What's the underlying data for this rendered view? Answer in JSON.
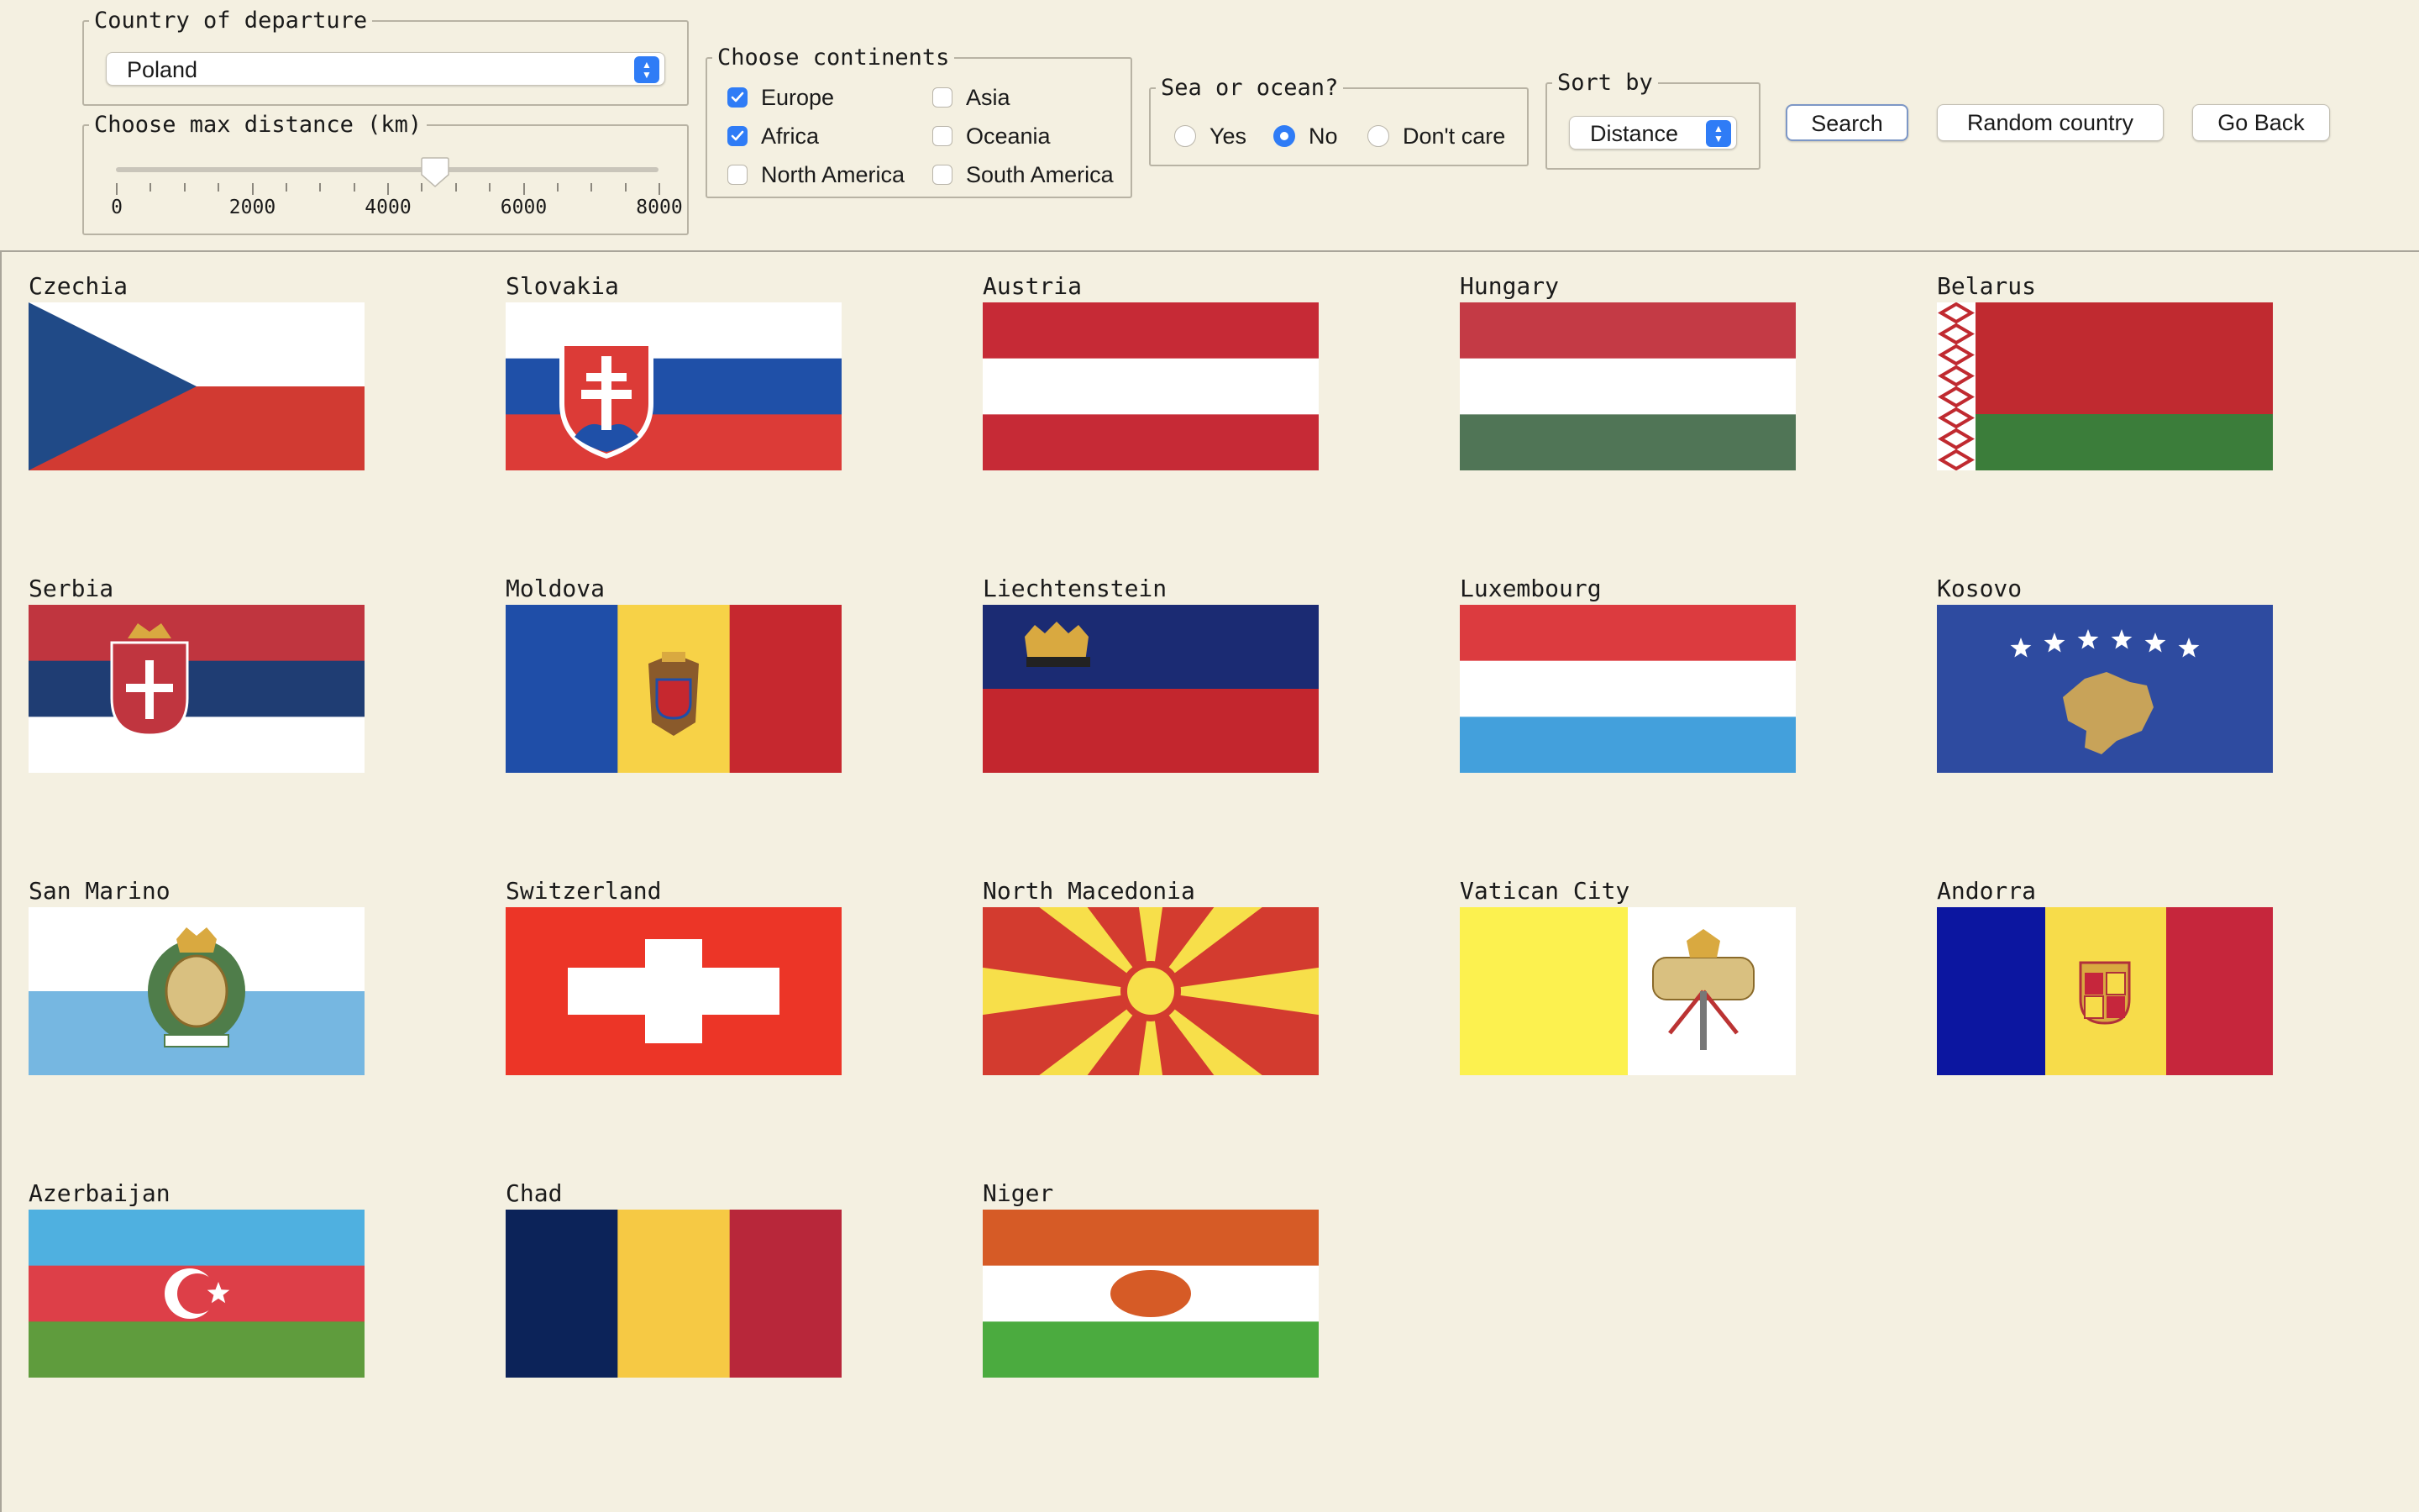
{
  "departure": {
    "legend": "Country of departure",
    "selected": "Poland"
  },
  "distance": {
    "legend": "Choose max distance (km)",
    "value_km": 4700,
    "min": 0,
    "max": 8000,
    "tick_labels": [
      "0",
      "2000",
      "4000",
      "6000",
      "8000"
    ]
  },
  "continents": {
    "legend": "Choose continents",
    "items": [
      {
        "label": "Europe",
        "checked": true
      },
      {
        "label": "Africa",
        "checked": true
      },
      {
        "label": "North America",
        "checked": false
      },
      {
        "label": "Asia",
        "checked": false
      },
      {
        "label": "Oceania",
        "checked": false
      },
      {
        "label": "South America",
        "checked": false
      }
    ]
  },
  "sea": {
    "legend": "Sea or ocean?",
    "options": [
      {
        "label": "Yes",
        "selected": false
      },
      {
        "label": "No",
        "selected": true
      },
      {
        "label": "Don't care",
        "selected": false
      }
    ]
  },
  "sort": {
    "legend": "Sort by",
    "selected": "Distance"
  },
  "buttons": {
    "search": "Search",
    "random": "Random country",
    "back": "Go Back"
  },
  "countries": [
    {
      "name": "Czechia",
      "flag": "czechia"
    },
    {
      "name": "Slovakia",
      "flag": "slovakia"
    },
    {
      "name": "Austria",
      "flag": "austria"
    },
    {
      "name": "Hungary",
      "flag": "hungary"
    },
    {
      "name": "Belarus",
      "flag": "belarus"
    },
    {
      "name": "Serbia",
      "flag": "serbia"
    },
    {
      "name": "Moldova",
      "flag": "moldova"
    },
    {
      "name": "Liechtenstein",
      "flag": "liechtenstein"
    },
    {
      "name": "Luxembourg",
      "flag": "luxembourg"
    },
    {
      "name": "Kosovo",
      "flag": "kosovo"
    },
    {
      "name": "San Marino",
      "flag": "san-marino"
    },
    {
      "name": "Switzerland",
      "flag": "switzerland"
    },
    {
      "name": "North Macedonia",
      "flag": "north-macedonia"
    },
    {
      "name": "Vatican City",
      "flag": "vatican-city"
    },
    {
      "name": "Andorra",
      "flag": "andorra"
    },
    {
      "name": "Azerbaijan",
      "flag": "azerbaijan"
    },
    {
      "name": "Chad",
      "flag": "chad"
    },
    {
      "name": "Niger",
      "flag": "niger"
    }
  ],
  "colors": {
    "background": "#f4f0e1",
    "accent": "#2f7cf6",
    "groupBorder": "#b8b3a4"
  }
}
